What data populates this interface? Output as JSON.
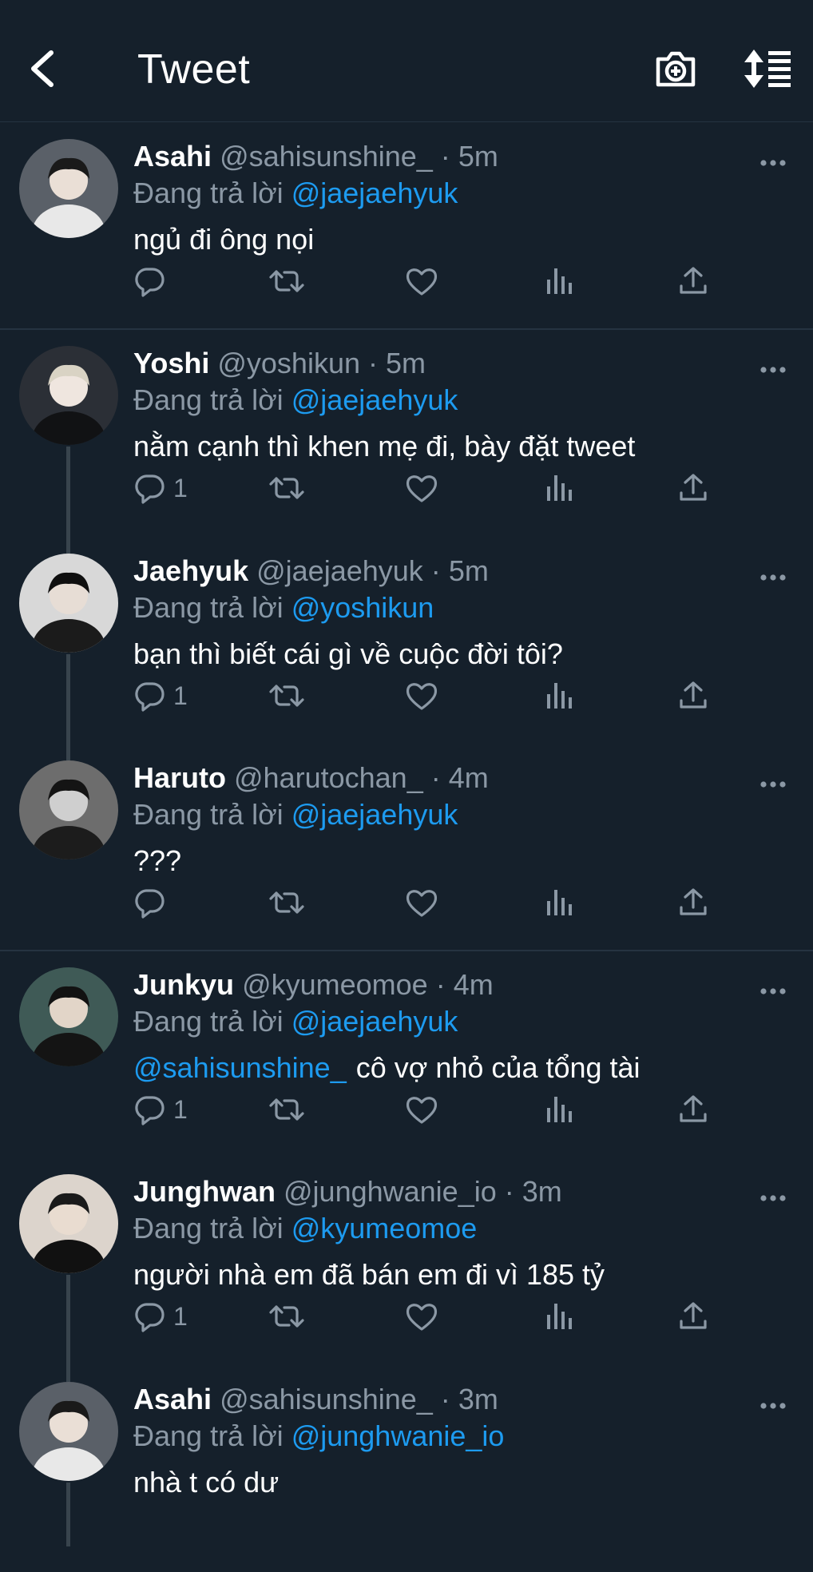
{
  "header": {
    "title": "Tweet"
  },
  "icons": {
    "back": "chevron-left-icon",
    "camera": "camera-plus-icon",
    "sort": "sort-list-icon",
    "reply": "reply-icon",
    "retweet": "retweet-icon",
    "like": "heart-icon",
    "views": "bar-chart-icon",
    "share": "share-icon"
  },
  "colors": {
    "background": "#15202b",
    "accent": "#1d9bf0",
    "muted": "#8b98a5",
    "divider": "#253341"
  },
  "reply_prefix": "Đang trả lời",
  "tweets": [
    {
      "name": "Asahi",
      "handle": "@sahisunshine_",
      "time": "5m",
      "reply_to": "@jaejaehyuk",
      "mention": "",
      "text": "ngủ đi ông nọi",
      "reply_count": ""
    },
    {
      "name": "Yoshi",
      "handle": "@yoshikun",
      "time": "5m",
      "reply_to": "@jaejaehyuk",
      "mention": "",
      "text": "nằm cạnh thì khen mẹ đi, bày đặt tweet",
      "reply_count": "1"
    },
    {
      "name": "Jaehyuk",
      "handle": "@jaejaehyuk",
      "time": "5m",
      "reply_to": "@yoshikun",
      "mention": "",
      "text": "bạn thì biết cái gì về cuộc đời tôi?",
      "reply_count": "1"
    },
    {
      "name": "Haruto",
      "handle": "@harutochan_",
      "time": "4m",
      "reply_to": "@jaejaehyuk",
      "mention": "",
      "text": "???",
      "reply_count": ""
    },
    {
      "name": "Junkyu",
      "handle": "@kyumeomoe",
      "time": "4m",
      "reply_to": "@jaejaehyuk",
      "mention": "@sahisunshine_",
      "text": "cô vợ nhỏ của tổng tài",
      "reply_count": "1"
    },
    {
      "name": "Junghwan",
      "handle": "@junghwanie_io",
      "time": "3m",
      "reply_to": "@kyumeomoe",
      "mention": "",
      "text": "người nhà em đã bán em đi vì 185 tỷ",
      "reply_count": "1"
    },
    {
      "name": "Asahi",
      "handle": "@sahisunshine_",
      "time": "3m",
      "reply_to": "@junghwanie_io",
      "mention": "",
      "text": "nhà t có dư",
      "reply_count": ""
    }
  ]
}
